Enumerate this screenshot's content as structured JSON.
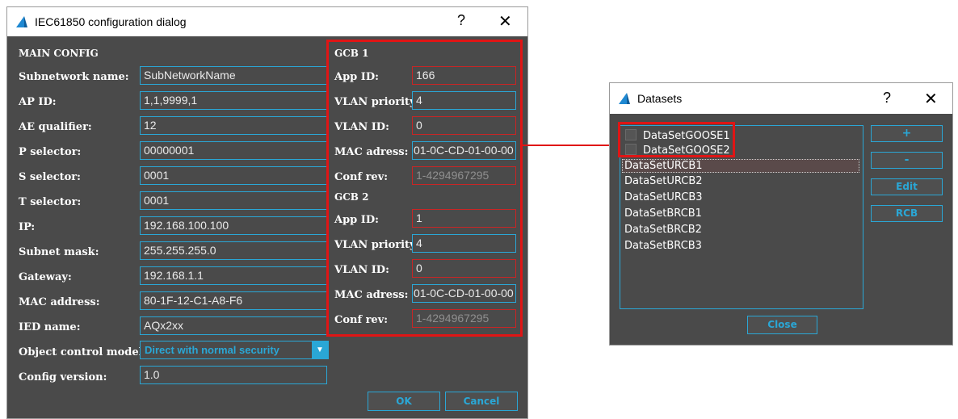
{
  "config_dialog": {
    "title": "IEC61850 configuration dialog",
    "help": "?",
    "close": "✕",
    "main_config": {
      "header": "MAIN CONFIG",
      "fields": [
        {
          "label": "Subnetwork name:",
          "value": "SubNetworkName"
        },
        {
          "label": "AP ID:",
          "value": "1,1,9999,1"
        },
        {
          "label": "AE qualifier:",
          "value": "12"
        },
        {
          "label": "P selector:",
          "value": "00000001"
        },
        {
          "label": "S selector:",
          "value": "0001"
        },
        {
          "label": "T selector:",
          "value": "0001"
        },
        {
          "label": "IP:",
          "value": "192.168.100.100"
        },
        {
          "label": "Subnet mask:",
          "value": "255.255.255.0"
        },
        {
          "label": "Gateway:",
          "value": "192.168.1.1"
        },
        {
          "label": "MAC address:",
          "value": "80-1F-12-C1-A8-F6"
        },
        {
          "label": "IED name:",
          "value": "AQx2xx"
        }
      ],
      "object_control": {
        "label": "Object control model:",
        "value": "Direct with normal security"
      },
      "config_version": {
        "label": "Config version:",
        "value": "1.0"
      }
    },
    "gcb1": {
      "header": "GCB 1",
      "app_id": {
        "label": "App ID:",
        "value": "166"
      },
      "vlan_priority": {
        "label": "VLAN priority:",
        "value": "4"
      },
      "vlan_id": {
        "label": "VLAN ID:",
        "value": "0"
      },
      "mac": {
        "label": "MAC adress:",
        "value": "01-0C-CD-01-00-00"
      },
      "conf_rev": {
        "label": "Conf rev:",
        "value": "1-4294967295"
      }
    },
    "gcb2": {
      "header": "GCB 2",
      "app_id": {
        "label": "App ID:",
        "value": "1"
      },
      "vlan_priority": {
        "label": "VLAN priority:",
        "value": "4"
      },
      "vlan_id": {
        "label": "VLAN ID:",
        "value": "0"
      },
      "mac": {
        "label": "MAC adress:",
        "value": "01-0C-CD-01-00-00"
      },
      "conf_rev": {
        "label": "Conf rev:",
        "value": "1-4294967295"
      }
    },
    "ok_label": "OK",
    "cancel_label": "Cancel"
  },
  "datasets_dialog": {
    "title": "Datasets",
    "help": "?",
    "close": "✕",
    "goose_items": [
      "DataSetGOOSE1",
      "DataSetGOOSE2"
    ],
    "items": [
      "DataSetURCB1",
      "DataSetURCB2",
      "DataSetURCB3",
      "DataSetBRCB1",
      "DataSetBRCB2",
      "DataSetBRCB3"
    ],
    "add_label": "+",
    "remove_label": "-",
    "edit_label": "Edit",
    "rcb_label": "RCB",
    "close_label": "Close"
  },
  "colors": {
    "accent": "#2aa7d6",
    "highlight": "#e01515",
    "window_bg": "#4a4a4a"
  }
}
